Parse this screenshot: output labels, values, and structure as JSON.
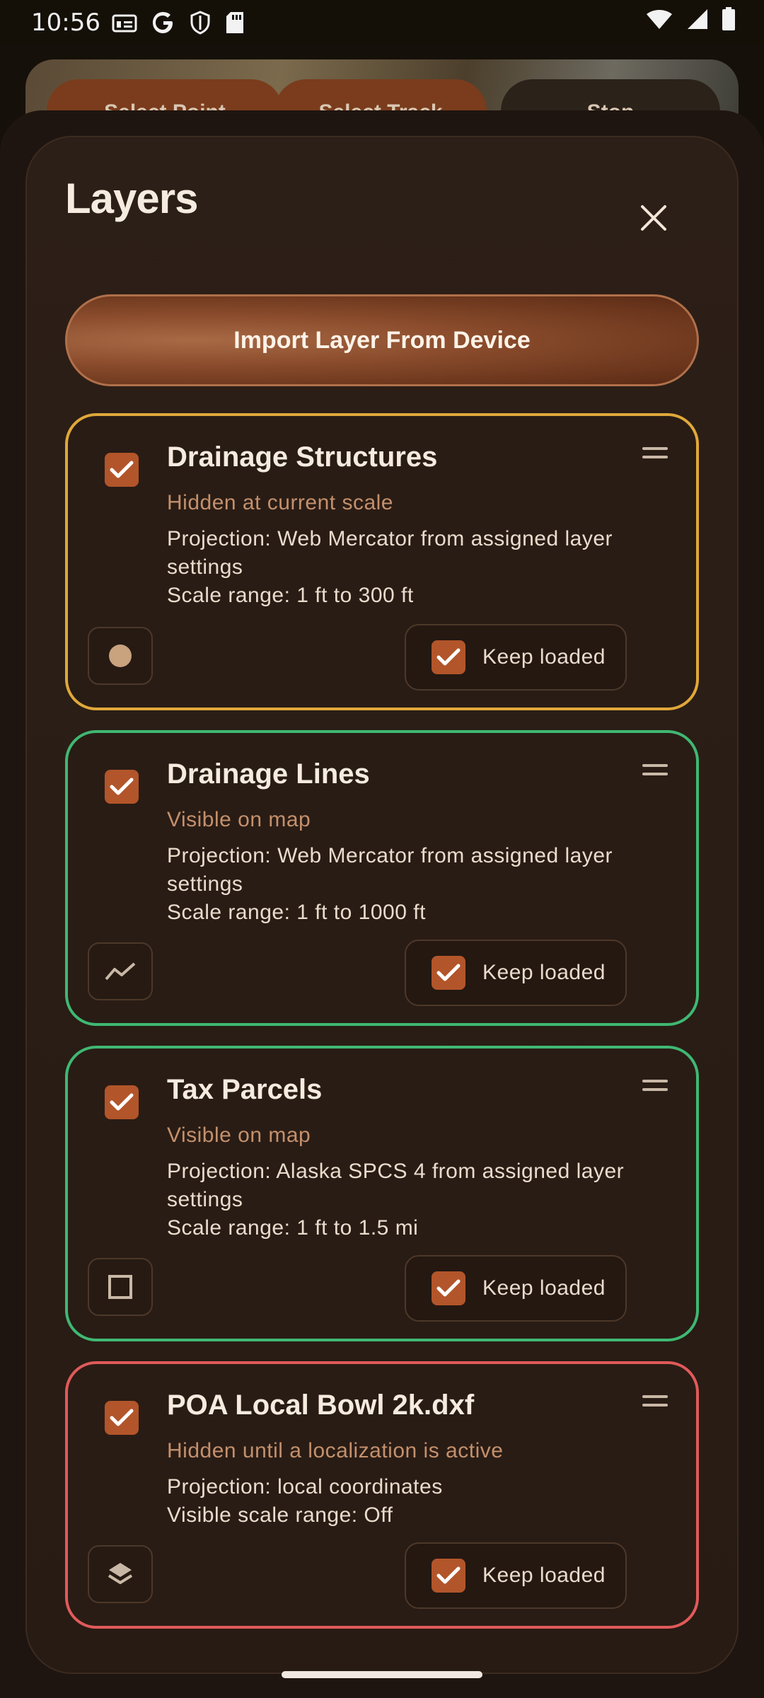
{
  "status_bar": {
    "time": "10:56",
    "left_icons": [
      "id-card-icon",
      "google-icon",
      "shield-icon",
      "sd-card-icon"
    ],
    "right_icons": [
      "wifi-icon",
      "cellular-icon",
      "battery-icon"
    ]
  },
  "map": {
    "chips": [
      "Select Point",
      "Select Track",
      "Stop"
    ]
  },
  "sheet": {
    "title": "Layers",
    "import_button_label": "Import Layer From Device",
    "layers": [
      {
        "name": "Drainage Structures",
        "checked": true,
        "status": "Hidden at current scale",
        "projection": "Projection: Web Mercator from assigned layer settings",
        "scale": "Scale range: 1 ft to 300 ft",
        "geometry_icon": "point-icon",
        "keep_loaded_label": "Keep loaded",
        "keep_loaded": true,
        "border_color": "#e0a83a"
      },
      {
        "name": "Drainage Lines",
        "checked": true,
        "status": "Visible on map",
        "projection": "Projection: Web Mercator from assigned layer settings",
        "scale": "Scale range: 1 ft to 1000 ft",
        "geometry_icon": "polyline-icon",
        "keep_loaded_label": "Keep loaded",
        "keep_loaded": true,
        "border_color": "#3fb872"
      },
      {
        "name": "Tax Parcels",
        "checked": true,
        "status": "Visible on map",
        "projection": "Projection: Alaska SPCS 4 from assigned layer settings",
        "scale": "Scale range: 1 ft to 1.5 mi",
        "geometry_icon": "polygon-icon",
        "keep_loaded_label": "Keep loaded",
        "keep_loaded": true,
        "border_color": "#3fb872"
      },
      {
        "name": "POA Local Bowl 2k.dxf",
        "checked": true,
        "status": "Hidden until a localization is active",
        "projection": "Projection: local coordinates",
        "scale": "Visible scale range: Off",
        "geometry_icon": "layers-icon",
        "keep_loaded_label": "Keep loaded",
        "keep_loaded": true,
        "border_color": "#e05a5a"
      }
    ]
  },
  "colors": {
    "accent": "#b2552a",
    "status_text": "#c4906c",
    "panel_bg": "#2c1f17"
  }
}
